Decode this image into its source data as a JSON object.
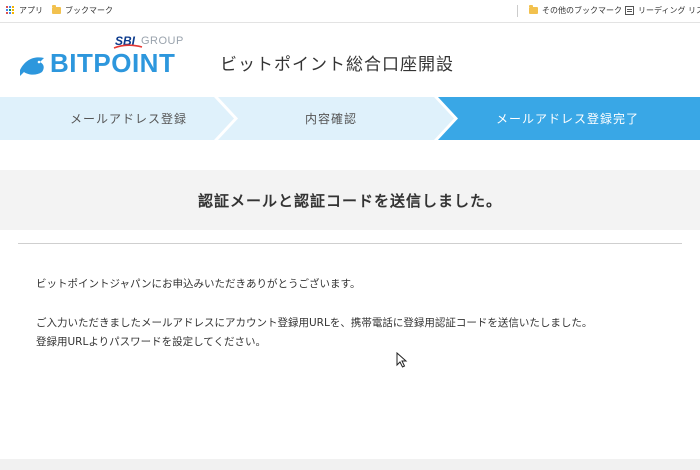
{
  "bookmarks_bar": {
    "apps_label": "アプリ",
    "bookmarks_label": "ブックマーク",
    "other_bookmarks_label": "その他のブックマーク",
    "reading_list_label": "リーディング リスト"
  },
  "header": {
    "logo": {
      "sbi": "SBI",
      "group": "GROUP",
      "wordmark": "BITPOINT"
    },
    "title": "ビットポイント総合口座開設"
  },
  "steps": [
    {
      "label": "メールアドレス登録",
      "state": "done"
    },
    {
      "label": "内容確認",
      "state": "done"
    },
    {
      "label": "メールアドレス登録完了",
      "state": "active"
    }
  ],
  "notice": {
    "title": "認証メールと認証コードを送信しました。"
  },
  "message": {
    "line1": "ビットポイントジャパンにお申込みいただきありがとうございます。",
    "line2": "ご入力いただきましたメールアドレスにアカウント登録用URLを、携帯電話に登録用認証コードを送信いたしました。",
    "line3": "登録用URLよりパスワードを設定してください。"
  },
  "colors": {
    "brand_blue": "#2d97dd",
    "step_inactive": "#dff1fb",
    "step_active": "#39a7e6",
    "notice_bg": "#f3f3f3"
  },
  "icons": [
    "apps-icon",
    "folder-icon",
    "reading-list-icon",
    "bird-logo-icon",
    "mouse-cursor-icon"
  ]
}
